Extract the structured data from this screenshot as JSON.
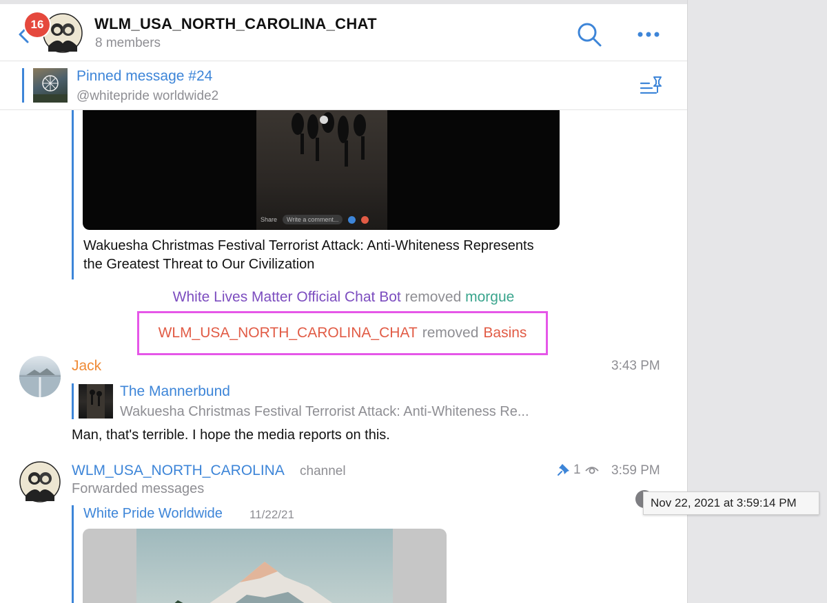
{
  "header": {
    "unread_badge": "16",
    "title": "WLM_USA_NORTH_CAROLINA_CHAT",
    "members": "8 members"
  },
  "pinned": {
    "title": "Pinned message #24",
    "username": "@whitepride worldwide2"
  },
  "forwarded_post": {
    "caption": "Wakuesha Christmas Festival Terrorist Attack: Anti-Whiteness Represents the Greatest Threat to Our Civilization",
    "video_share_label": "Share",
    "video_comment_placeholder": "Write a comment..."
  },
  "service_messages": [
    {
      "actor": "White Lives Matter Official Chat Bot",
      "action": "removed",
      "target": "morgue"
    },
    {
      "actor": "WLM_USA_NORTH_CAROLINA_CHAT",
      "action": "removed",
      "target": "Basins"
    }
  ],
  "messages": [
    {
      "sender": "Jack",
      "time": "3:43 PM",
      "reply_to": {
        "title": "The Mannerbund",
        "text": "Wakuesha Christmas Festival Terrorist Attack: Anti-Whiteness Re..."
      },
      "text": "Man, that's terrible. I hope the media reports on this."
    },
    {
      "sender": "WLM_USA_NORTH_CAROLINA",
      "sender_tag": "channel",
      "status": "Forwarded messages",
      "views": "1",
      "time": "3:59 PM",
      "forwarded_from": "White Pride Worldwide",
      "forwarded_date": "11/22/21"
    }
  ],
  "tooltip": {
    "text": "Nov 22, 2021 at 3:59:14 PM"
  },
  "colors": {
    "accent_blue": "#3d85d8",
    "badge_red": "#e5483d",
    "highlight_border": "#e556e8",
    "jack_orange": "#ef8a35",
    "bot_purple": "#7c4dbf",
    "removed_green": "#3aa58d",
    "removed_red": "#e15b45"
  }
}
